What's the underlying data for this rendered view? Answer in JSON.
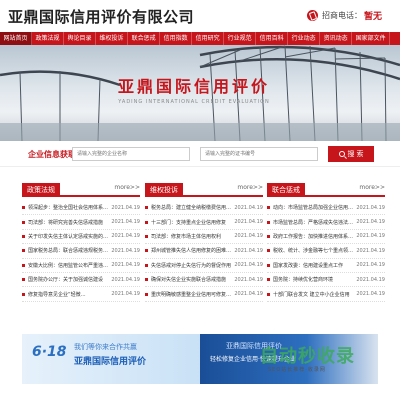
{
  "header": {
    "site_title": "亚鼎国际信用评价有限公司",
    "hotline_label": "招商电话：",
    "hotline_value": "暂无"
  },
  "nav": {
    "items": [
      "网站首页",
      "政策法规",
      "舆论目录",
      "维权投诉",
      "联合惩戒",
      "信用指数",
      "信用研究",
      "行业规范",
      "信用百科",
      "行业动态",
      "资讯动态",
      "国家部文件"
    ]
  },
  "banner": {
    "title": "亚鼎国际信用评价",
    "subtitle": "YADING INTERNATIONAL CREDIT EVALUATION"
  },
  "search": {
    "label": "企业信息获取：",
    "company_placeholder": "请输入完整的企业名称",
    "cert_placeholder": "请输入完整的证书编号",
    "button_label": "搜 索"
  },
  "columns": [
    {
      "title": "政策法规",
      "more": "more>>",
      "items": [
        {
          "title": "领深起步：整治全国社会信用体系突出问题",
          "date": "2021.04.19"
        },
        {
          "title": "司法部：将研究完善失信惩戒措施",
          "date": "2021.04.19"
        },
        {
          "title": "关于印发失信主体认定惩戒实施的通知",
          "date": "2021.04.19"
        },
        {
          "title": "国家税务总局：联合惩戒违规税务失信问题",
          "date": "2021.04.19"
        },
        {
          "title": "安徽大比例：信用监管公布严重违法失信名单",
          "date": "2021.04.19"
        },
        {
          "title": "国务院办公厅：关于加强诚信建设",
          "date": "2021.04.19"
        },
        {
          "title": "修复指导意见企业“轻微…",
          "date": "2021.04.19"
        }
      ]
    },
    {
      "title": "维权投诉",
      "more": "more>>",
      "items": [
        {
          "title": "税务总局：建立健全纳税缴费信用评价体系",
          "date": "2021.04.19"
        },
        {
          "title": "十三部门：支持重点企业信用修复",
          "date": "2021.04.19"
        },
        {
          "title": "司法部：修复市场主体信用权利",
          "date": "2021.04.19"
        },
        {
          "title": "郑州城管推失信人信用修复的困难问题",
          "date": "2021.04.19"
        },
        {
          "title": "失信惩戒对停止失信行为的督促作用",
          "date": "2021.04.19"
        },
        {
          "title": "确保对失信企业实施联合惩戒措施",
          "date": "2021.04.19"
        },
        {
          "title": "重庆明确敏感重整企业信用可修复问题",
          "date": "2021.04.19"
        }
      ]
    },
    {
      "title": "联合惩戒",
      "more": "more>>",
      "items": [
        {
          "title": "动向：市场监管总局加强企业信用建设",
          "date": "2021.04.19"
        },
        {
          "title": "市场监管总局：严格惩戒失信违法行为",
          "date": "2021.04.19"
        },
        {
          "title": "政府工作报告：加快推进信用体系建设",
          "date": "2021.04.19"
        },
        {
          "title": "税收、统计、涉金融等七个重点领域失信",
          "date": "2021.04.19"
        },
        {
          "title": "国家发改委：信用建设重点工作",
          "date": "2021.04.19"
        },
        {
          "title": "国务院：持续优化营商环境",
          "date": "2021.04.19"
        },
        {
          "title": "十部门联合发文 建立中小企业信用",
          "date": "2021.04.19"
        }
      ]
    }
  ],
  "ads": {
    "left_badge": "6·18",
    "left_line1": "我们等你来合作共赢",
    "left_line2": "亚鼎国际信用评价",
    "right_line1": "亚鼎国际信用评价",
    "right_line2": "轻松修复企业信用·快速提升企业",
    "watermark": "自动秒收录",
    "watermark_sub": "SEO站长推荐·收录网"
  }
}
